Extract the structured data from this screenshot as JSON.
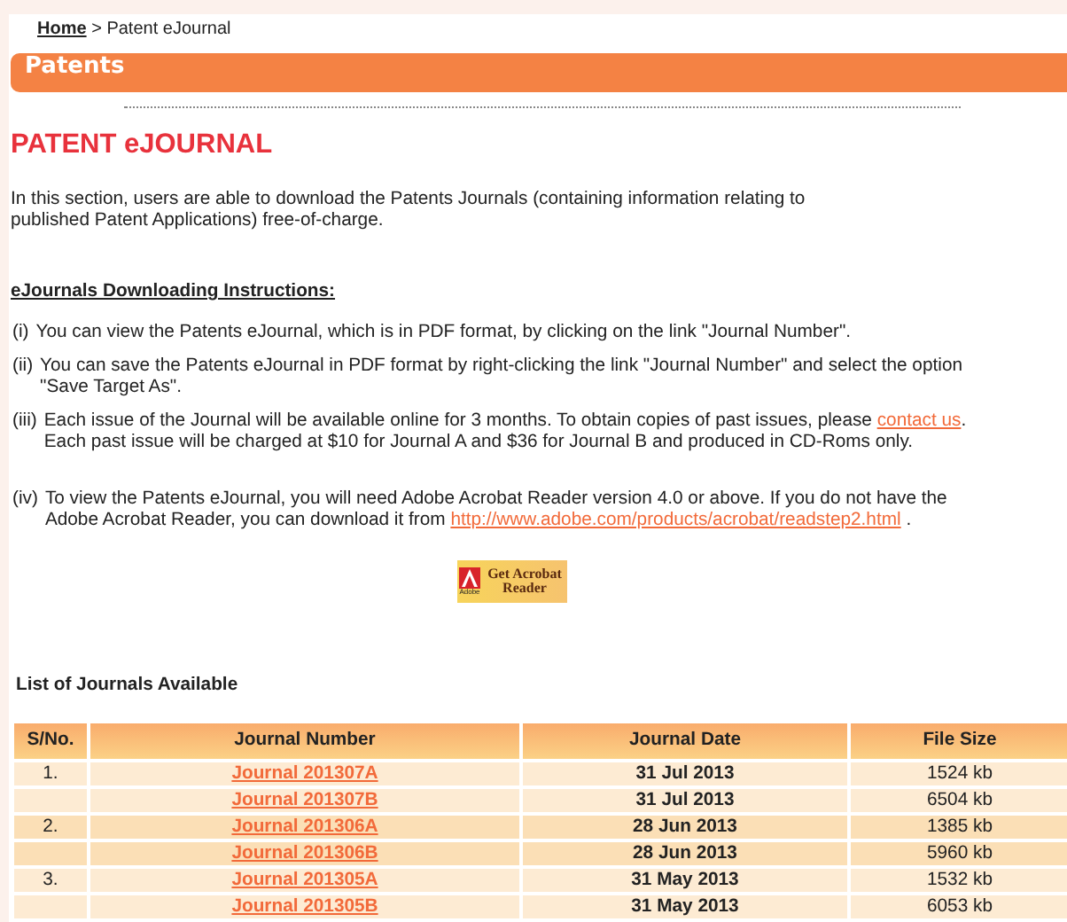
{
  "breadcrumb": {
    "home": "Home",
    "separator": ">",
    "current": "Patent eJournal"
  },
  "section_bar": {
    "title": "Patents"
  },
  "page_title": "PATENT eJOURNAL",
  "intro": "In this section, users are able to download the Patents Journals (containing information relating to published Patent Applications) free-of-charge.",
  "instructions_heading": "eJournals Downloading Instructions:",
  "instructions": [
    {
      "marker": "(i)",
      "text": "You can view the Patents eJournal, which is in PDF format, by clicking on the link \"Journal Number\"."
    },
    {
      "marker": "(ii)",
      "text": "You can save the Patents eJournal in PDF format by right-clicking the link \"Journal Number\" and select the option \"Save Target As\"."
    },
    {
      "marker": "(iii)",
      "text": "Each issue of the Journal will be available online for 3 months. To obtain copies of past issues, please",
      "link": "contact us",
      "after": ". Each past issue will be charged at $10 for Journal A and $36 for Journal B and produced in CD-Roms only."
    },
    {
      "marker": "(iv)",
      "text": "To view the Patents eJournal, you will need Adobe Acrobat Reader version 4.0 or above. If you do not have the Adobe Acrobat Reader, you can download it from",
      "link": "http://www.adobe.com/products/acrobat/readstep2.html",
      "after": " ."
    }
  ],
  "acrobat_badge": {
    "text": "Get Acrobat Reader",
    "brand": "Adobe"
  },
  "journals_heading": "List of Journals Available",
  "table": {
    "columns": [
      "S/No.",
      "Journal Number",
      "Journal Date",
      "File Size"
    ],
    "groups": [
      {
        "sno": "1.",
        "rows": [
          {
            "journal": "Journal 201307A",
            "date": "31 Jul 2013",
            "size": "1524 kb"
          },
          {
            "journal": "Journal 201307B",
            "date": "31 Jul 2013",
            "size": "6504 kb"
          }
        ]
      },
      {
        "sno": "2.",
        "rows": [
          {
            "journal": "Journal 201306A",
            "date": "28 Jun 2013",
            "size": "1385 kb"
          },
          {
            "journal": "Journal 201306B",
            "date": "28 Jun 2013",
            "size": "5960 kb"
          }
        ]
      },
      {
        "sno": "3.",
        "rows": [
          {
            "journal": "Journal 201305A",
            "date": "31 May 2013",
            "size": "1532 kb"
          },
          {
            "journal": "Journal 201305B",
            "date": "31 May 2013",
            "size": "6053 kb"
          }
        ]
      }
    ]
  }
}
